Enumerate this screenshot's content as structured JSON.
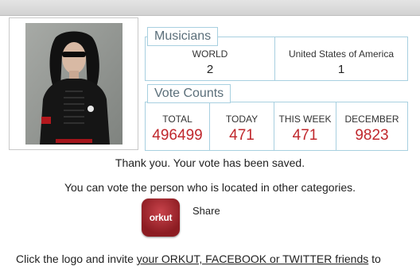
{
  "musicians": {
    "title": "Musicians",
    "columns": [
      {
        "label": "WORLD",
        "value": "2"
      },
      {
        "label": "United States of America",
        "value": "1"
      }
    ]
  },
  "vote_counts": {
    "title": "Vote Counts",
    "columns": [
      {
        "label": "TOTAL",
        "value": "496499"
      },
      {
        "label": "TODAY",
        "value": "471"
      },
      {
        "label": "THIS WEEK",
        "value": "471"
      },
      {
        "label": "DECEMBER",
        "value": "9823"
      }
    ]
  },
  "messages": {
    "thanks": "Thank you. Your vote has been saved.",
    "other_categories": "You can vote the person who is located in other categories."
  },
  "share": {
    "logo_text": "orkut",
    "label": "Share"
  },
  "invite": {
    "prefix": "Click the logo and invite ",
    "link": "your ORKUT, FACEBOOK or TWITTER friends",
    "suffix": " to"
  },
  "colors": {
    "accent_red": "#c0282d",
    "panel_border": "#a8d0e0",
    "orkut_red": "#8c1c22"
  }
}
